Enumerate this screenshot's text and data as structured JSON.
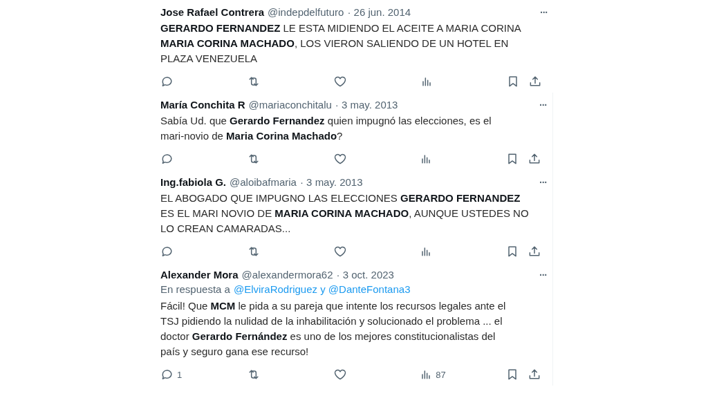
{
  "tweets": [
    {
      "name": "Jose Rafael Contrera",
      "handle": "@indepdelfuturo",
      "date": "· 26 jun. 2014",
      "more": "···",
      "body": "**GERARDO FERNANDEZ** LE ESTA MIDIENDO EL ACEITE A MARIA CORINA\n**MARIA CORINA MACHADO**, LOS VIERON SALIENDO DE UN HOTEL EN\nPLAZA VENEZUELA"
    },
    {
      "name": "María Conchita R",
      "handle": "@mariaconchitalu",
      "date": "· 3 may. 2013",
      "more": "···",
      "body": "Sabía Ud. que **Gerardo Fernandez** quien impugnó las elecciones, es el\nmari-novio de **Maria Corina Machado**?"
    },
    {
      "name": "Ing.fabiola G.",
      "handle": "@aloibafmaria",
      "date": "· 3 may. 2013",
      "more": "···",
      "body": "EL ABOGADO QUE IMPUGNO LAS ELECCIONES **GERARDO FERNANDEZ**\nES EL MARI NOVIO DE **MARIA CORINA MACHADO**, AUNQUE USTEDES NO\nLO CREAN CAMARADAS..."
    },
    {
      "name": "Alexander Mora",
      "handle": "@alexandermora62",
      "date": "· 3 oct. 2023",
      "more": "···",
      "reply_prefix": "En respuesta a",
      "reply_to": "@ElviraRodriguez y @DanteFontana3",
      "body": "Fácil! Que **MCM** le pida a su pareja que intente los recursos legales ante el\nTSJ pidiendo la nulidad de la inhabilitación y solucionado el problema ... el\ndoctor **Gerardo Fernández** es uno de los mejores constitucionalistas del\npaís y seguro gana ese recurso!",
      "replies": "1",
      "views": "87"
    }
  ]
}
